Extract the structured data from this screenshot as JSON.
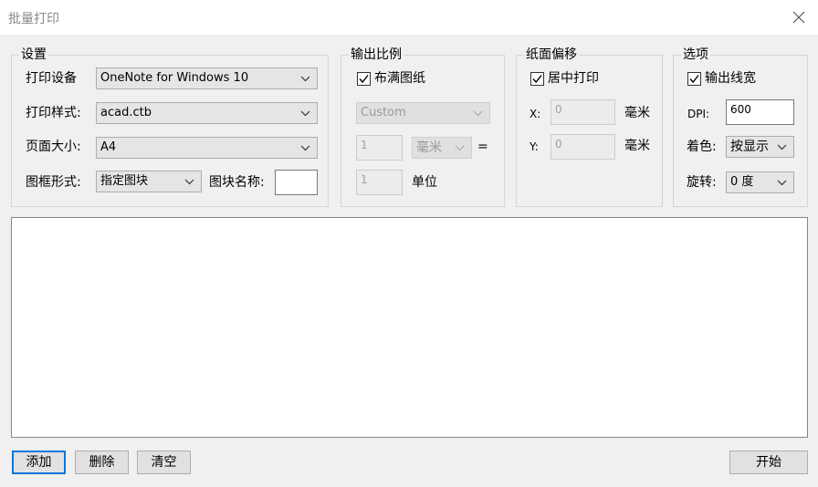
{
  "window": {
    "title": "批量打印"
  },
  "settings": {
    "legend": "设置",
    "device_label": "打印设备",
    "device_value": "OneNote for Windows 10",
    "style_label": "打印样式:",
    "style_value": "acad.ctb",
    "size_label": "页面大小:",
    "size_value": "A4",
    "frame_label": "图框形式:",
    "frame_value": "指定图块",
    "block_label": "图块名称:",
    "block_value": ""
  },
  "scale": {
    "legend": "输出比例",
    "fit_label": "布满图纸",
    "fit_checked": true,
    "preset_value": "Custom",
    "mm_value": "1",
    "mm_unit": "毫米",
    "equals": "=",
    "units_value": "1",
    "units_label": "单位"
  },
  "offset": {
    "legend": "纸面偏移",
    "center_label": "居中打印",
    "center_checked": true,
    "x_label": "X:",
    "x_value": "0",
    "x_unit": "毫米",
    "y_label": "Y:",
    "y_value": "0",
    "y_unit": "毫米"
  },
  "options": {
    "legend": "选项",
    "lineweight_label": "输出线宽",
    "lineweight_checked": true,
    "dpi_label": "DPI:",
    "dpi_value": "600",
    "color_label": "着色:",
    "color_value": "按显示",
    "rotate_label": "旋转:",
    "rotate_value": "0 度"
  },
  "buttons": {
    "add": "添加",
    "delete": "删除",
    "clear": "清空",
    "start": "开始"
  },
  "colors": {
    "accent": "#0078d7",
    "background": "#f0f0f0",
    "titlebar": "#ffffff"
  }
}
